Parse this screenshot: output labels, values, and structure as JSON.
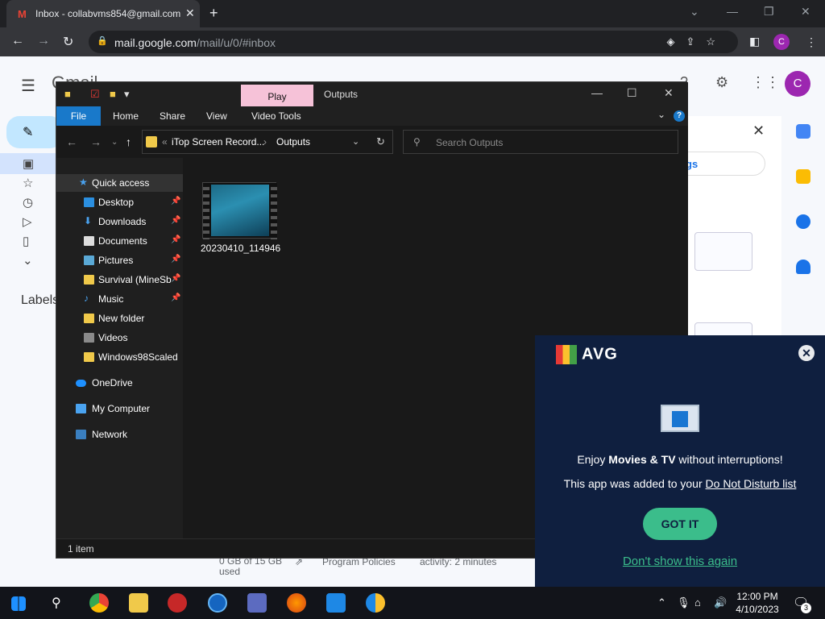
{
  "browser": {
    "tab_title": "Inbox - collabvms854@gmail.com",
    "tab_favicon": "M",
    "close_tab_glyph": "✕",
    "new_tab_glyph": "+",
    "url_host": "mail.google.com",
    "url_path": "/mail/u/0/#inbox",
    "profile_initial": "C",
    "window_controls": [
      "⌄",
      "—",
      "❐",
      "✕"
    ]
  },
  "gmail": {
    "logo_text": "Gmail",
    "compose_glyph": "✎",
    "labels_heading": "Labels",
    "avatar_initial": "C",
    "panel_link": "gs",
    "footer": {
      "storage": "0 GB of 15 GB used",
      "policies": "Program Policies",
      "activity": "activity: 2 minutes"
    }
  },
  "explorer": {
    "ribbon_context_tab": "Play",
    "window_title": "Outputs",
    "ribbon_tabs": [
      "File",
      "Home",
      "Share",
      "View",
      "Video Tools"
    ],
    "breadcrumb": [
      "iTop Screen Record...",
      "Outputs"
    ],
    "search_placeholder": "Search Outputs",
    "nav_items": [
      {
        "label": "Quick access",
        "icon": "star-icon",
        "pinned": false
      },
      {
        "label": "Desktop",
        "icon": "desktop-icon",
        "pinned": true
      },
      {
        "label": "Downloads",
        "icon": "downloads-icon",
        "pinned": true
      },
      {
        "label": "Documents",
        "icon": "documents-icon",
        "pinned": true
      },
      {
        "label": "Pictures",
        "icon": "pictures-icon",
        "pinned": true
      },
      {
        "label": "Survival (MineSb",
        "icon": "folder-icon",
        "pinned": true
      },
      {
        "label": "Music",
        "icon": "music-icon",
        "pinned": true
      },
      {
        "label": "New folder",
        "icon": "folder-icon",
        "pinned": false
      },
      {
        "label": "Videos",
        "icon": "videos-icon",
        "pinned": false
      },
      {
        "label": "Windows98Scaled",
        "icon": "folder-icon",
        "pinned": false
      },
      {
        "label": "OneDrive",
        "icon": "cloud-icon",
        "pinned": false
      },
      {
        "label": "My Computer",
        "icon": "computer-icon",
        "pinned": false
      },
      {
        "label": "Network",
        "icon": "network-icon",
        "pinned": false
      }
    ],
    "files": [
      {
        "name": "20230410_114946",
        "type": "video"
      }
    ],
    "status": "1 item"
  },
  "avg": {
    "brand": "AVG",
    "line1_pre": "Enjoy ",
    "line1_bold": "Movies & TV",
    "line1_post": " without interruptions!",
    "line2_pre": "This app was added to your ",
    "line2_link": "Do Not Disturb list",
    "got_it": "GOT IT",
    "dont_show": "Don't show this again",
    "close_glyph": "✕"
  },
  "taskbar": {
    "apps": [
      "start-icon",
      "search-icon",
      "chrome-icon",
      "file-explorer-icon",
      "redcircle-icon",
      "ccleaner-icon",
      "p-app-icon",
      "firefox-icon",
      "shield-icon",
      "chrome-alt-icon"
    ],
    "clock_time": "12:00 PM",
    "clock_date": "4/10/2023",
    "notification_count": "3"
  },
  "colors": {
    "explorer_bg": "#191919",
    "ribbon_accent": "#1979ca",
    "play_tab": "#f6c2d8",
    "avg_bg": "#0f1f3f",
    "avg_green": "#3bbd8b"
  }
}
